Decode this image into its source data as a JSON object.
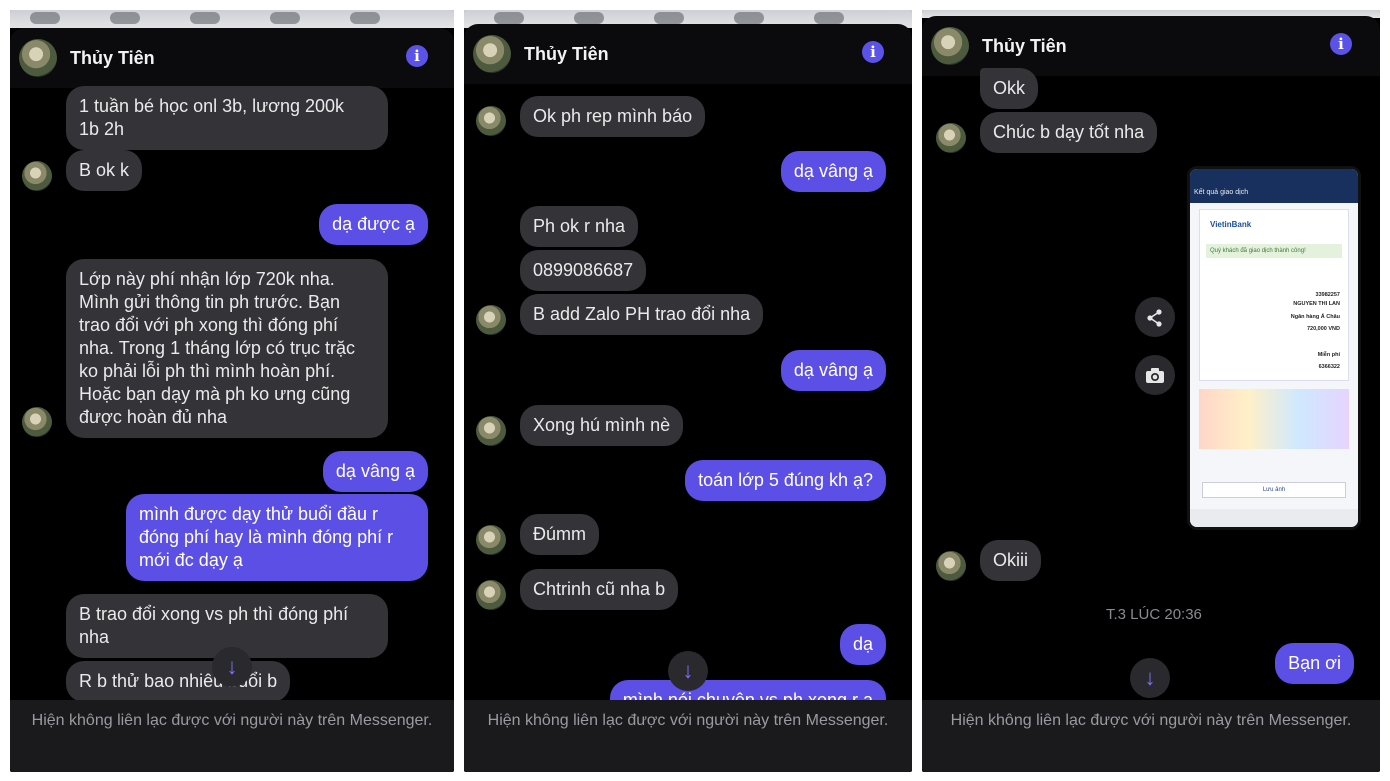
{
  "contact_name": "Thủy Tiên",
  "footer_text": "Hiện không liên lạc được với người này trên Messenger.",
  "panel1": {
    "messages": [
      {
        "text": "1 tuần bé học onl 3b, lương 200k\n1b 2h",
        "dir": "in"
      },
      {
        "text": "B ok k",
        "dir": "in"
      },
      {
        "text": "dạ được ạ",
        "dir": "out"
      },
      {
        "text": "Lớp này phí nhận lớp 720k nha.\nMình gửi thông tin ph trước. Bạn\ntrao đổi với ph xong thì đóng phí\nnha. Trong 1 tháng lớp có trục trặc\nko phải lỗi ph thì mình hoàn phí.\nHoặc bạn dạy mà ph ko ưng cũng\nđược hoàn đủ nha",
        "dir": "in"
      },
      {
        "text": "dạ vâng ạ",
        "dir": "out"
      },
      {
        "text": "mình được dạy thử buổi đầu r\nđóng phí hay là mình đóng phí r\nmới đc dạy ạ",
        "dir": "out"
      },
      {
        "text": "B trao đổi xong vs ph thì đóng phí\nnha",
        "dir": "in"
      },
      {
        "text": "R b thử bao nhiêu buổi b",
        "dir": "in"
      }
    ]
  },
  "panel2": {
    "messages": [
      {
        "text": "Ok ph rep mình báo",
        "dir": "in"
      },
      {
        "text": "dạ vâng ạ",
        "dir": "out"
      },
      {
        "text": "Ph ok r nha",
        "dir": "in"
      },
      {
        "text": "0899086687",
        "dir": "in"
      },
      {
        "text": "B add Zalo PH trao đổi nha",
        "dir": "in"
      },
      {
        "text": "dạ vâng ạ",
        "dir": "out"
      },
      {
        "text": "Xong hú mình nè",
        "dir": "in"
      },
      {
        "text": "toán lớp 5 đúng kh ạ?",
        "dir": "out"
      },
      {
        "text": "Đúmm",
        "dir": "in"
      },
      {
        "text": "Chtrinh cũ nha b",
        "dir": "in"
      },
      {
        "text": "dạ",
        "dir": "out"
      },
      {
        "text": "mình nói chuyện vs ph xong r ạ",
        "dir": "out"
      }
    ]
  },
  "panel3": {
    "messages": [
      {
        "text": "Okk",
        "dir": "in"
      },
      {
        "text": "Chúc b dạy tốt nha",
        "dir": "in"
      },
      {
        "text": "Okiii",
        "dir": "in"
      },
      {
        "text": "Bạn ơi",
        "dir": "out"
      }
    ],
    "timestamp": "T.3 LÚC 20:36",
    "receipt": {
      "title": "Kết quả giao dịch",
      "brand": "VietinBank",
      "success": "Quý khách đã giao dịch thành công!",
      "account_to": "33982257",
      "recipient": "NGUYEN THI LAN",
      "bank": "Ngân hàng Á Châu",
      "amount": "720,000 VND",
      "fee": "Miễn phí",
      "content": "6366322",
      "save_label": "Lưu ảnh"
    }
  },
  "icons": {
    "info": "info-icon",
    "scroll_down": "arrow-down-icon",
    "share": "share-icon",
    "camera": "camera-icon"
  },
  "colors": {
    "accent": "#5b4fe6",
    "incoming_bubble": "#333338",
    "background": "#000000"
  }
}
